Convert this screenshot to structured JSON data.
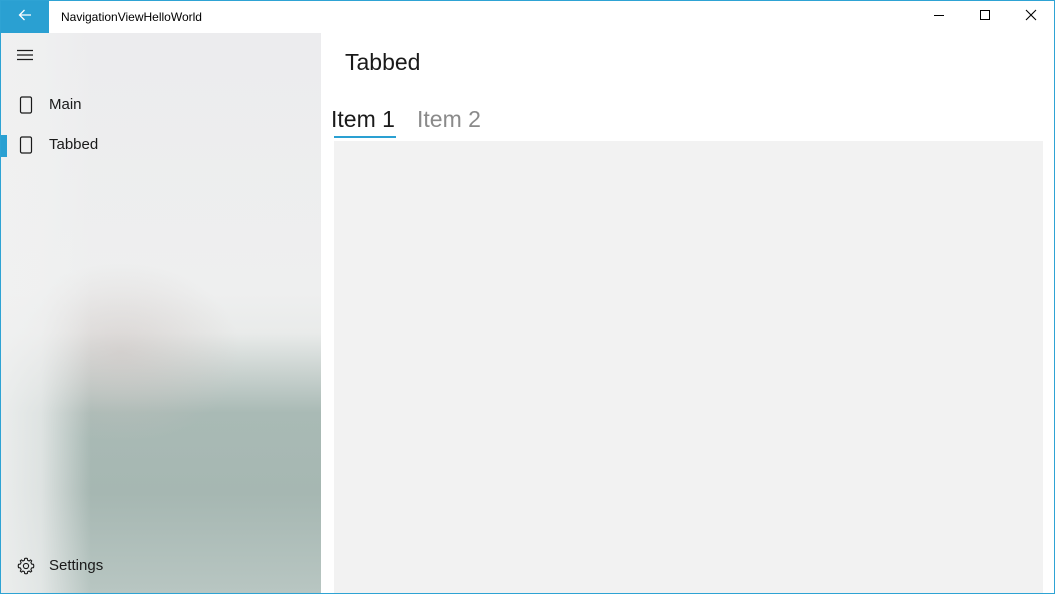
{
  "titlebar": {
    "app_title": "NavigationViewHelloWorld",
    "back_icon": "arrow-left-icon",
    "accent_color": "#2aa0d2",
    "caption_icons": [
      "minimize-icon",
      "maximize-icon",
      "close-icon"
    ]
  },
  "nav": {
    "menu_icon": "hamburger-icon",
    "items": [
      {
        "label": "Main",
        "icon": "document-icon",
        "selected": false
      },
      {
        "label": "Tabbed",
        "icon": "document-icon",
        "selected": true
      }
    ],
    "settings": {
      "label": "Settings",
      "icon": "gear-icon"
    }
  },
  "content": {
    "page_title": "Tabbed",
    "tabs": [
      {
        "label": "Item 1",
        "selected": true
      },
      {
        "label": "Item 2",
        "selected": false
      }
    ]
  }
}
